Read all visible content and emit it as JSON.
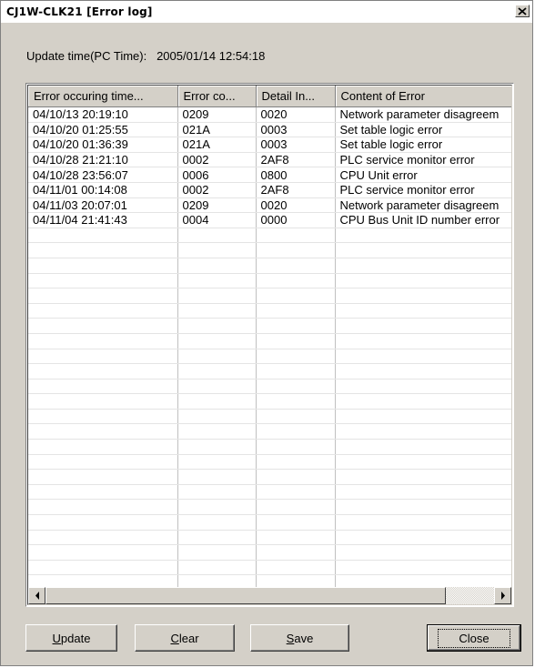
{
  "window": {
    "title": "CJ1W-CLK21 [Error log]"
  },
  "update_time": {
    "label": "Update time(PC Time):",
    "value": "2005/01/14 12:54:18"
  },
  "table": {
    "columns": [
      "Error occuring time...",
      "Error co...",
      "Detail In...",
      "Content of Error"
    ],
    "rows": [
      [
        "04/10/13 20:19:10",
        "0209",
        "0020",
        "Network parameter disagreem"
      ],
      [
        "04/10/20 01:25:55",
        "021A",
        "0003",
        "Set table logic error"
      ],
      [
        "04/10/20 01:36:39",
        "021A",
        "0003",
        "Set table logic error"
      ],
      [
        "04/10/28 21:21:10",
        "0002",
        "2AF8",
        "PLC service monitor error"
      ],
      [
        "04/10/28 23:56:07",
        "0006",
        "0800",
        "CPU Unit error"
      ],
      [
        "04/11/01 00:14:08",
        "0002",
        "2AF8",
        "PLC service monitor error"
      ],
      [
        "04/11/03 20:07:01",
        "0209",
        "0020",
        "Network parameter disagreem"
      ],
      [
        "04/11/04 21:41:43",
        "0004",
        "0000",
        "CPU Bus Unit ID number error"
      ]
    ]
  },
  "buttons": {
    "update": {
      "mnemonic": "U",
      "rest": "pdate"
    },
    "clear": {
      "mnemonic": "C",
      "rest": "lear"
    },
    "save": {
      "mnemonic": "S",
      "rest": "ave"
    },
    "close": "Close"
  },
  "icons": {
    "close": "close-x-icon",
    "scroll_left": "arrow-left-icon",
    "scroll_right": "arrow-right-icon"
  }
}
